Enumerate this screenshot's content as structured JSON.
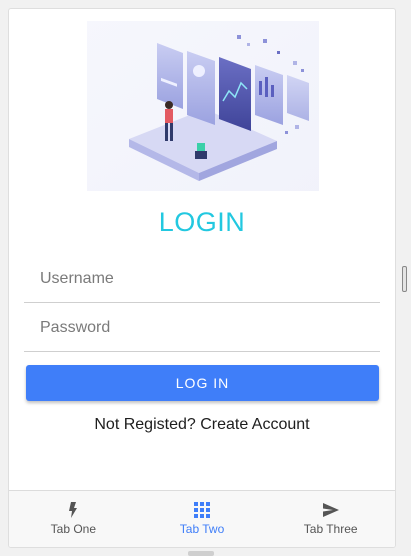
{
  "colors": {
    "title": "#22c8e0",
    "primary_button": "#3f7ef9",
    "active_tab": "#3f7ef9"
  },
  "hero": {
    "illustration": "analytics-dashboard-illustration"
  },
  "login": {
    "title": "LOGIN",
    "username_placeholder": "Username",
    "password_placeholder": "Password",
    "button_label": "LOG IN",
    "register_link": "Not Registed? Create Account"
  },
  "tabs": [
    {
      "label": "Tab One",
      "icon": "flash-icon",
      "active": false
    },
    {
      "label": "Tab Two",
      "icon": "apps-grid-icon",
      "active": true
    },
    {
      "label": "Tab Three",
      "icon": "send-icon",
      "active": false
    }
  ]
}
